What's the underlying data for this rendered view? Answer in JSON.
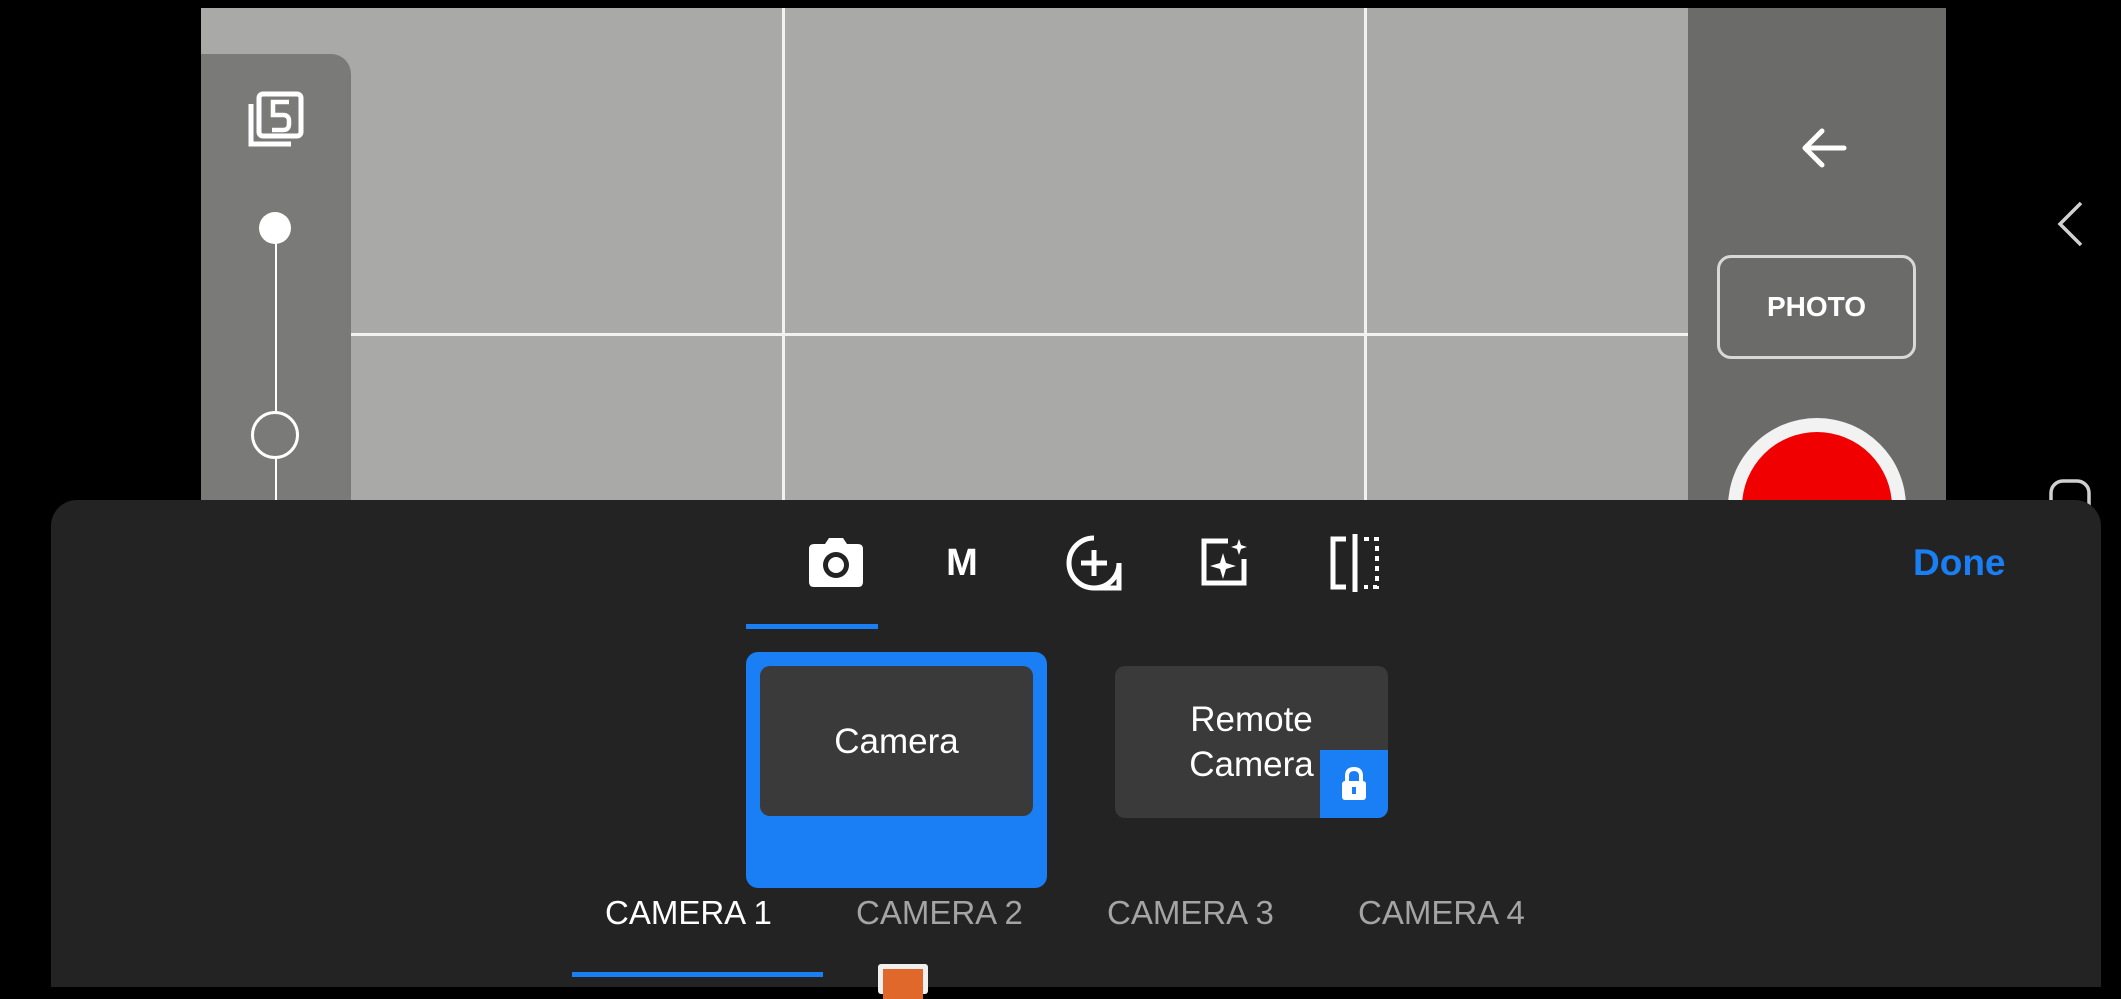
{
  "right_controls": {
    "mode_label": "PHOTO"
  },
  "sheet": {
    "done_label": "Done",
    "mode_tabs": [
      {
        "icon": "camera-icon",
        "label": "",
        "active": true
      },
      {
        "icon": "manual-m-icon",
        "label": "M",
        "active": false
      },
      {
        "icon": "add-circle-icon",
        "label": "",
        "active": false
      },
      {
        "icon": "sparkle-frame-icon",
        "label": "",
        "active": false
      },
      {
        "icon": "split-compare-icon",
        "label": "",
        "active": false
      }
    ],
    "sources": [
      {
        "label": "Camera",
        "selected": true,
        "locked": false
      },
      {
        "label_line1": "Remote",
        "label_line2": "Camera",
        "selected": false,
        "locked": true
      }
    ],
    "camera_tabs": [
      "CAMERA 1",
      "CAMERA 2",
      "CAMERA 3",
      "CAMERA 4"
    ],
    "active_camera_index": 0
  },
  "colors": {
    "accent": "#1a7ff5",
    "record": "#f00000",
    "sheet_bg": "#232323",
    "viewfinder": "#a9aaa8"
  }
}
